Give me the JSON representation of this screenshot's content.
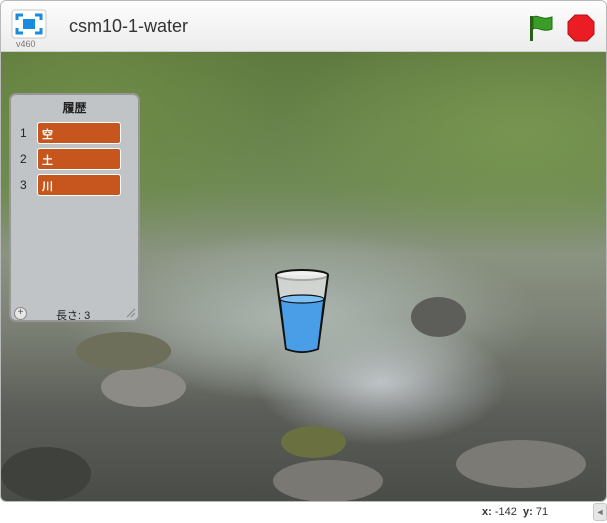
{
  "header": {
    "version": "v460",
    "project_title": "csm10-1-water",
    "fullscreen_icon": "fullscreen-icon",
    "flag_icon": "green-flag-icon",
    "stop_icon": "stop-icon",
    "flag_color": "#2e7d1f",
    "stop_color": "#e8121a"
  },
  "stage": {
    "scene": "forest stream",
    "sprite": "water-cup-icon",
    "cup_fill_color": "#4a9ee8",
    "list_monitor": {
      "title": "履歴",
      "items": [
        {
          "index": "1",
          "value": "空"
        },
        {
          "index": "2",
          "value": "土"
        },
        {
          "index": "3",
          "value": "川"
        }
      ],
      "add_label": "+",
      "length_label": "長さ: 3",
      "item_color": "#c6561e"
    }
  },
  "footer": {
    "x_label": "x:",
    "x_value": "-142",
    "y_label": "y:",
    "y_value": "71",
    "arrow": "◄"
  }
}
